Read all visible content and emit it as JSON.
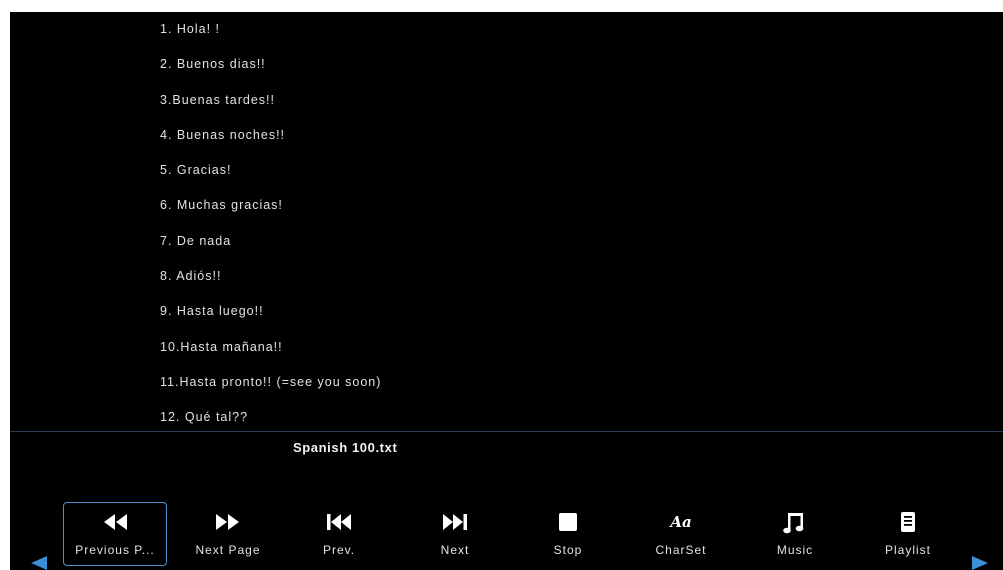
{
  "document": {
    "lines": [
      "1. Hola! !",
      "2. Buenos dias!!",
      "3.Buenas tardes!!",
      "4. Buenas noches!!",
      "5. Gracias!",
      "6. Muchas gracias!",
      "7. De nada",
      "8. Adiós!!",
      "9. Hasta luego!!",
      "10.Hasta mañana!!",
      "11.Hasta pronto!! (=see you soon)",
      "12. Qué tal??"
    ],
    "filename": "Spanish 100.txt"
  },
  "toolbar": {
    "buttons": [
      {
        "label": "Previous P...",
        "icon": "rewind-icon",
        "selected": true
      },
      {
        "label": "Next Page",
        "icon": "fast-forward-icon",
        "selected": false
      },
      {
        "label": "Prev.",
        "icon": "skip-previous-icon",
        "selected": false
      },
      {
        "label": "Next",
        "icon": "skip-next-icon",
        "selected": false
      },
      {
        "label": "Stop",
        "icon": "stop-icon",
        "selected": false
      },
      {
        "label": "CharSet",
        "icon": "charset-icon",
        "glyph": "Aa",
        "selected": false
      },
      {
        "label": "Music",
        "icon": "music-note-icon",
        "selected": false
      },
      {
        "label": "Playlist",
        "icon": "playlist-icon",
        "selected": false
      }
    ],
    "nav_left_icon": "scroll-left-arrow-icon",
    "nav_right_icon": "scroll-right-arrow-icon"
  },
  "colors": {
    "background": "#000000",
    "text": "#e2e2e2",
    "accent": "#3a8fd6",
    "selected_border": "#4d8fd0"
  }
}
